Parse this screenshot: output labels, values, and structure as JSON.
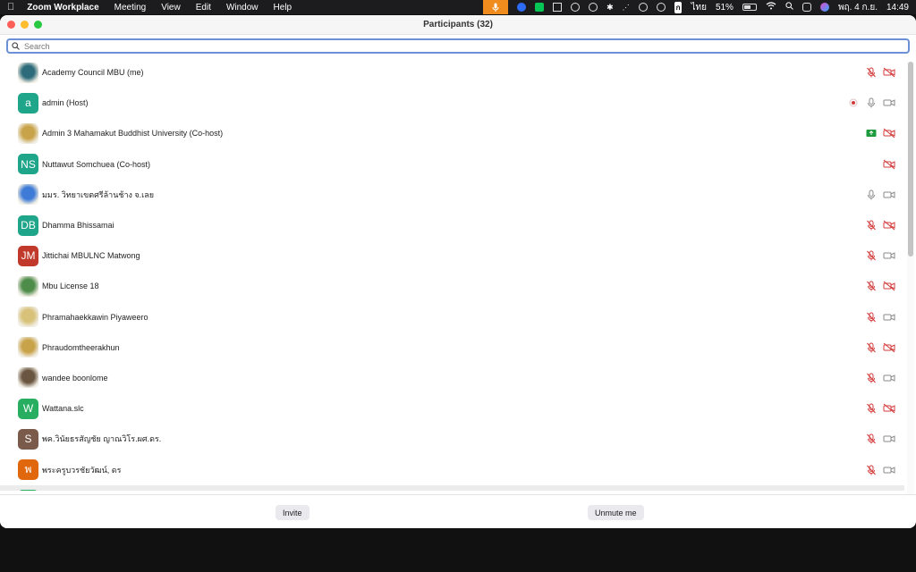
{
  "menubar": {
    "app_name": "Zoom Workplace",
    "menus": [
      "Meeting",
      "View",
      "Edit",
      "Window",
      "Help"
    ],
    "input_lang": "ก",
    "input_lang_label": "ไทย",
    "battery": "51%",
    "date": "พฤ. 4 ก.ย.",
    "time": "14:49"
  },
  "window": {
    "title": "Participants (32)"
  },
  "search": {
    "placeholder": "Search"
  },
  "participants": [
    {
      "name": "Academy Council MBU (me)",
      "initials": "",
      "color": "#2d6b7a",
      "photo": true,
      "mic": "muted",
      "video": "off",
      "recording": false,
      "share": false
    },
    {
      "name": "admin (Host)",
      "initials": "a",
      "color": "#1fa58a",
      "photo": false,
      "mic": "on",
      "video": "on",
      "recording": true,
      "share": false
    },
    {
      "name": "Admin 3 Mahamakut Buddhist University (Co-host)",
      "initials": "",
      "color": "#c9a34a",
      "photo": true,
      "mic": "none",
      "video": "off",
      "recording": false,
      "share": true
    },
    {
      "name": "Nuttawut Somchuea (Co-host)",
      "initials": "NS",
      "color": "#1fa58a",
      "photo": false,
      "mic": "none",
      "video": "off",
      "recording": false,
      "share": false
    },
    {
      "name": "มมร. วิทยาเขตศรีล้านช้าง จ.เลย",
      "initials": "",
      "color": "#3e7bd6",
      "photo": true,
      "mic": "on",
      "video": "on",
      "recording": false,
      "share": false
    },
    {
      "name": "Dhamma Bhissamai",
      "initials": "DB",
      "color": "#1fa58a",
      "photo": false,
      "mic": "muted",
      "video": "off",
      "recording": false,
      "share": false
    },
    {
      "name": "Jittichai MBULNC Matwong",
      "initials": "JM",
      "color": "#c0392b",
      "photo": false,
      "mic": "muted",
      "video": "on",
      "recording": false,
      "share": false
    },
    {
      "name": "Mbu License 18",
      "initials": "",
      "color": "#4e8c4a",
      "photo": true,
      "mic": "muted",
      "video": "off",
      "recording": false,
      "share": false
    },
    {
      "name": "Phramahaekkawin Piyaweero",
      "initials": "",
      "color": "#d8c27a",
      "photo": true,
      "mic": "muted",
      "video": "on",
      "recording": false,
      "share": false
    },
    {
      "name": "Phraudomtheerakhun",
      "initials": "",
      "color": "#c9a34a",
      "photo": true,
      "mic": "muted",
      "video": "off",
      "recording": false,
      "share": false
    },
    {
      "name": "wandee boonlome",
      "initials": "",
      "color": "#6a5540",
      "photo": true,
      "mic": "muted",
      "video": "on",
      "recording": false,
      "share": false
    },
    {
      "name": "Wattana.slc",
      "initials": "W",
      "color": "#27ae60",
      "photo": false,
      "mic": "muted",
      "video": "off",
      "recording": false,
      "share": false
    },
    {
      "name": "พค.วินัยธรสัญชัย ญาณวิโร.ผศ.ดร.",
      "initials": "S",
      "color": "#7a5a4a",
      "photo": false,
      "mic": "muted",
      "video": "on",
      "recording": false,
      "share": false
    },
    {
      "name": "พระครูบวรชัยวัฒน์, ดร",
      "initials": "พ",
      "color": "#e0670c",
      "photo": false,
      "mic": "muted",
      "video": "on",
      "recording": false,
      "share": false
    },
    {
      "name": "",
      "initials": "",
      "color": "#27ae60",
      "photo": false,
      "mic": "none",
      "video": "none",
      "recording": false,
      "share": false,
      "highlight": true
    }
  ],
  "footer": {
    "invite_label": "Invite",
    "unmute_label": "Unmute me"
  },
  "colors": {
    "muted_red": "#d33b3b",
    "icon_gray": "#8a8a8a",
    "share_green": "#1e9b3e",
    "search_border": "#6c8fd8"
  }
}
